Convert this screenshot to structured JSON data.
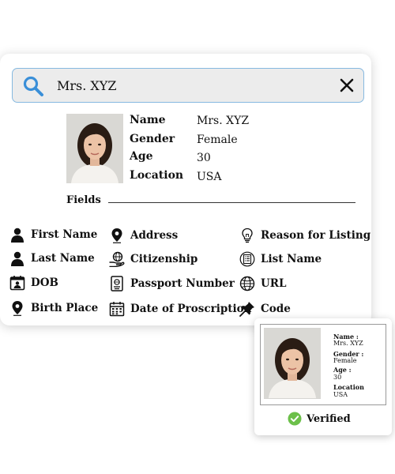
{
  "search": {
    "value": "Mrs. XYZ"
  },
  "profile": {
    "labels": [
      "Name",
      "Gender",
      "Age",
      "Location"
    ],
    "values": [
      "Mrs. XYZ",
      "Female",
      "30",
      "USA"
    ]
  },
  "fields": {
    "title": "Fields",
    "items": [
      {
        "label": "First Name",
        "icon": "person-icon"
      },
      {
        "label": "Last Name",
        "icon": "person-icon"
      },
      {
        "label": "DOB",
        "icon": "calendar-user-icon"
      },
      {
        "label": "Birth Place",
        "icon": "location-pin-icon"
      },
      {
        "label": "Address",
        "icon": "location-pin-icon"
      },
      {
        "label": "Citizenship",
        "icon": "globe-hand-icon"
      },
      {
        "label": "Passport Number",
        "icon": "passport-icon"
      },
      {
        "label": "Date of Proscription",
        "icon": "calendar-grid-icon"
      },
      {
        "label": "Reason for Listing",
        "icon": "lightbulb-icon"
      },
      {
        "label": "List Name",
        "icon": "list-icon"
      },
      {
        "label": "URL",
        "icon": "globe-icon"
      },
      {
        "label": "Code",
        "icon": "pushpin-icon"
      }
    ]
  },
  "verification": {
    "labels": [
      "Name :",
      "Gender :",
      "Age :",
      "Location"
    ],
    "values": [
      "Mrs. XYZ",
      "Female",
      "30",
      "USA"
    ],
    "status": "Verified",
    "status_color": "#6cc04a"
  },
  "colors": {
    "accent": "#3a8fd8",
    "search_border": "#86b9e0"
  }
}
